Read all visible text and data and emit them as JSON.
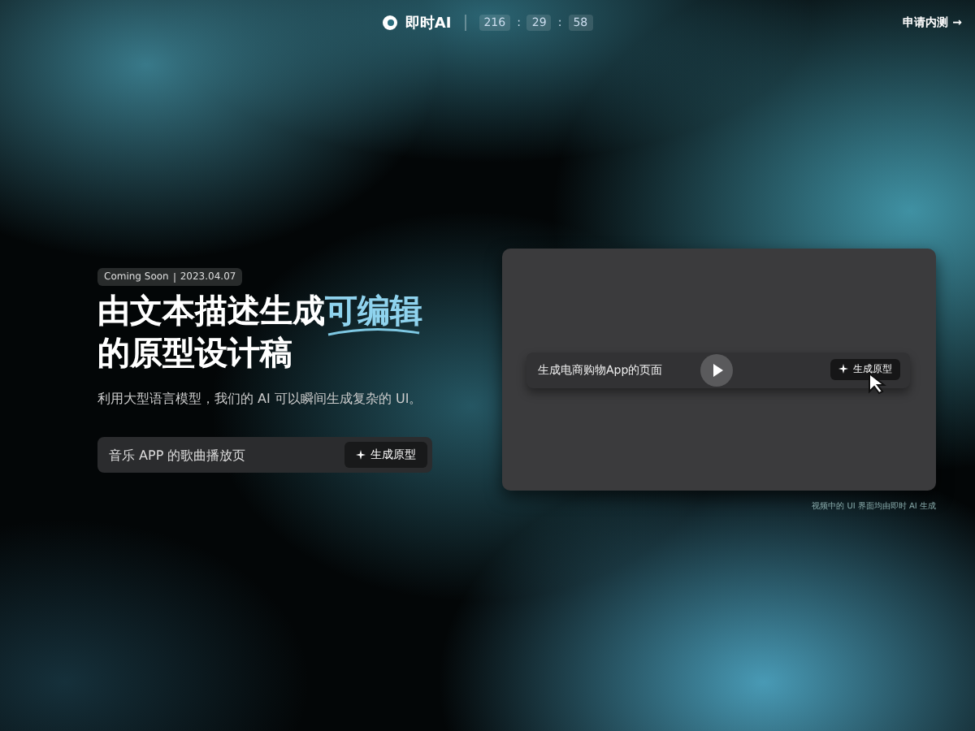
{
  "header": {
    "logo": "即时AI",
    "countdown": [
      "216",
      "29",
      "58"
    ],
    "separator": ":",
    "cta": "申请内测",
    "cta_arrow": "→"
  },
  "hero": {
    "badge": {
      "label": "Coming Soon",
      "date": "2023.04.07"
    },
    "title_line1": "由文本描述生成",
    "title_highlight": "可编辑",
    "title_line2": "的原型设计稿",
    "subtitle": "利用大型语言模型，我们的 AI 可以瞬间生成复杂的 UI。",
    "prompt": {
      "value": "音乐 APP 的歌曲播放页",
      "button": "生成原型"
    }
  },
  "demo": {
    "prompt_value": "生成电商购物App的页面",
    "button": "生成原型",
    "caption": "视频中的 UI 界面均由即时 AI 生成"
  }
}
